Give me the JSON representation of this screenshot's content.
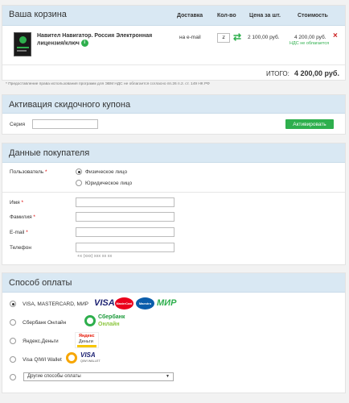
{
  "cart": {
    "title": "Ваша корзина",
    "columns": {
      "delivery": "Доставка",
      "qty": "Кол-во",
      "unit_price": "Цена за шт.",
      "cost": "Стоимость"
    },
    "item": {
      "name": "Навител Навигатор. Россия Электронная лицензия/ключ",
      "delivery": "на e-mail",
      "qty": "2",
      "unit_price": "2 100,00 руб.",
      "cost": "4 200,00 руб.",
      "vat_note": "НДС не облагается"
    },
    "total_label": "ИТОГО:",
    "total_value": "4 200,00 руб."
  },
  "footnote": "* Предоставление права использования программ для ЭВМ НДС не облагается согласно пп.26 п.2. ст. 149 НК РФ",
  "coupon": {
    "title": "Активация скидочного купона",
    "series_label": "Серия",
    "series_value": "",
    "activate_label": "Активировать"
  },
  "buyer": {
    "title": "Данные покупателя",
    "user_label": "Пользователь",
    "user_options": [
      "Физическое лицо",
      "Юридическое лицо"
    ],
    "name_label": "Имя",
    "surname_label": "Фамилия",
    "email_label": "E-mail",
    "phone_label": "Телефон",
    "phone_hint": "+x (xxx) xxx xx xx"
  },
  "payment": {
    "title": "Способ оплаты",
    "methods": [
      {
        "label": "VISA, MASTERCARD, МИР"
      },
      {
        "label": "Сбербанк Онлайн"
      },
      {
        "label": "Яндекс.Деньги"
      },
      {
        "label": "Visa QIWI Wallet"
      }
    ],
    "other_select": "Другие способы оплаты",
    "logos": {
      "visa": "VISA",
      "mastercard": "MasterCard",
      "maestro": "Maestro",
      "mir": "МИР",
      "sber_line1": "Сбербанк",
      "sber_line2": "Онлайн",
      "yandex_line1": "Яндекс",
      "yandex_line2": "Деньги",
      "qiwi_visa": "VISA",
      "qiwi_wallet": "QIWI WALLET"
    }
  },
  "colors": {
    "accent_green": "#2eaf4d",
    "header_blue": "#d9e8f3",
    "remove_red": "#cc2222"
  }
}
